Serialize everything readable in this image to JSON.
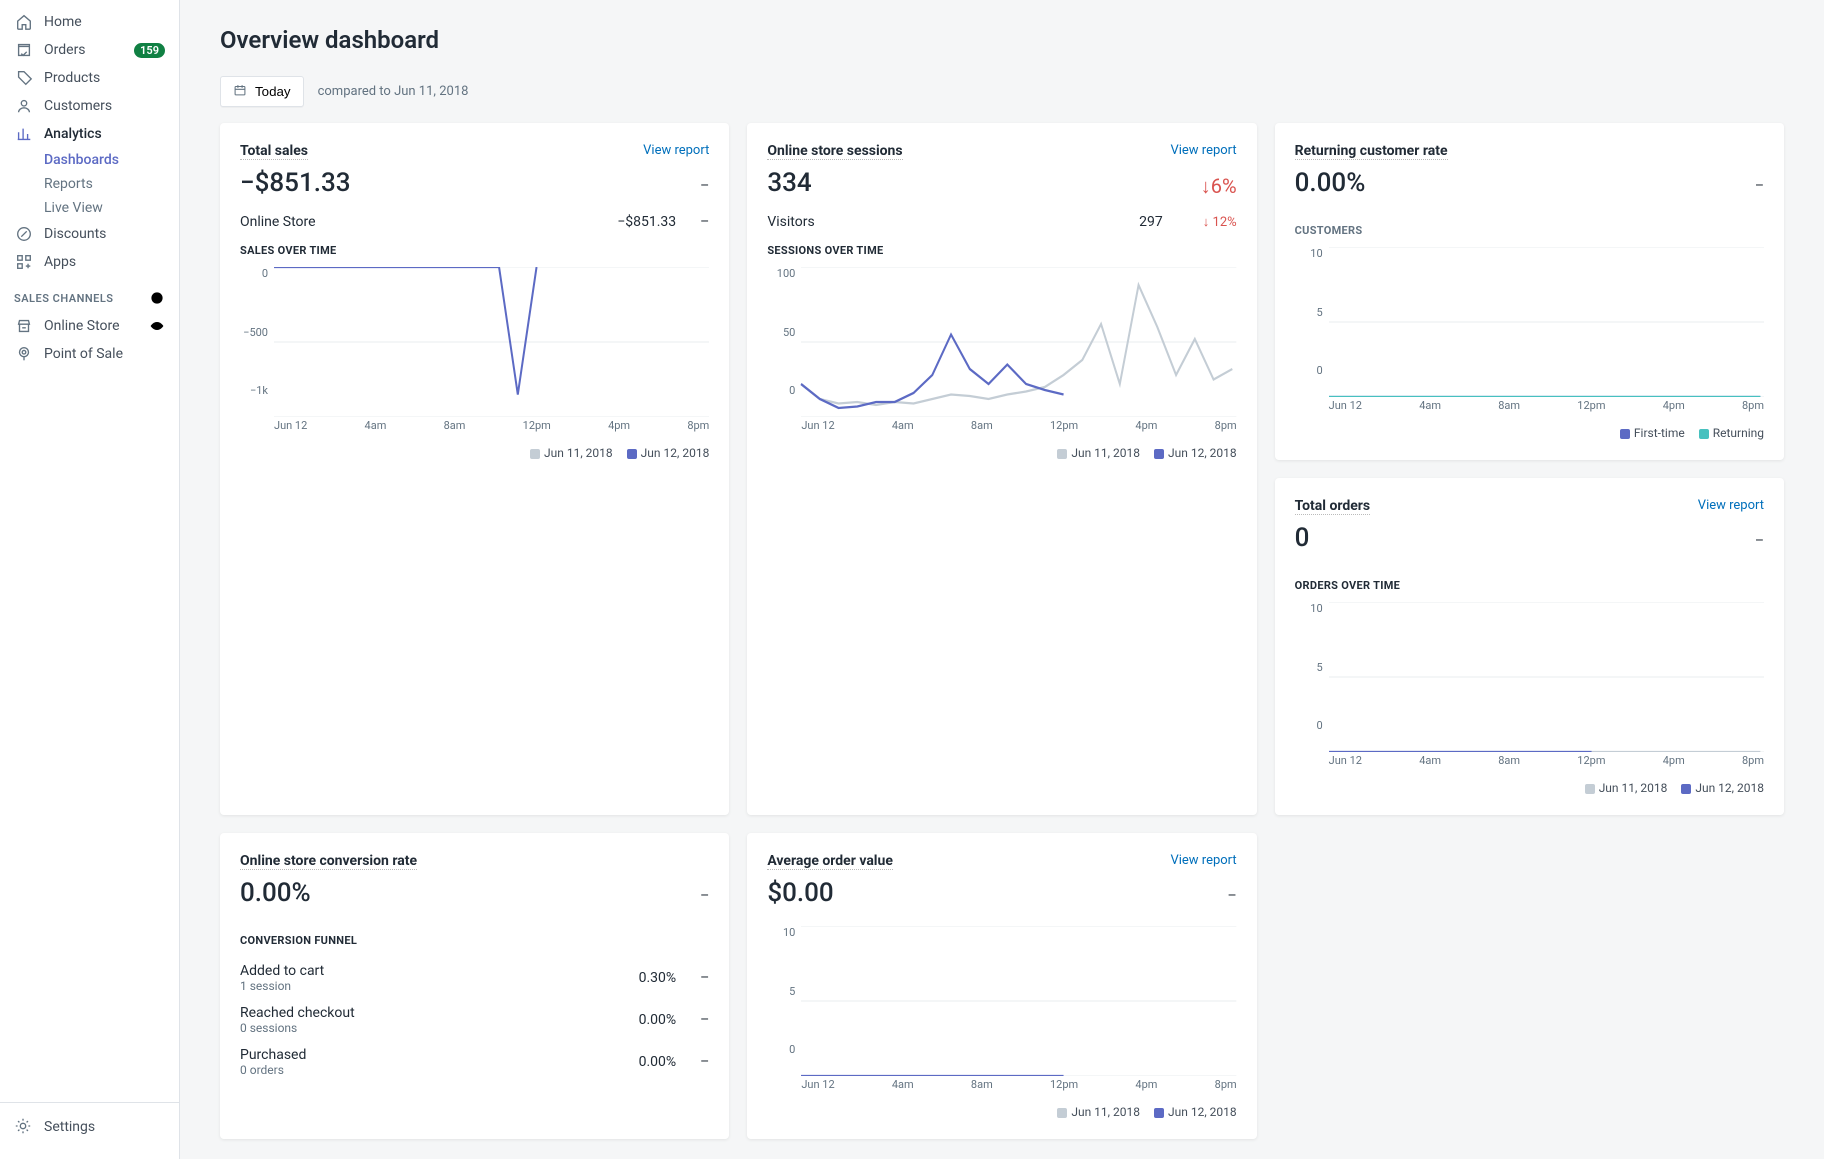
{
  "sidebar": {
    "items": [
      {
        "icon": "home",
        "label": "Home"
      },
      {
        "icon": "orders",
        "label": "Orders",
        "badge": "159"
      },
      {
        "icon": "tag",
        "label": "Products"
      },
      {
        "icon": "user",
        "label": "Customers"
      },
      {
        "icon": "chart",
        "label": "Analytics",
        "sub": [
          {
            "label": "Dashboards",
            "active": true
          },
          {
            "label": "Reports"
          },
          {
            "label": "Live View"
          }
        ]
      },
      {
        "icon": "discount",
        "label": "Discounts"
      },
      {
        "icon": "apps",
        "label": "Apps"
      }
    ],
    "channelsLabel": "SALES CHANNELS",
    "channels": [
      {
        "icon": "store",
        "label": "Online Store",
        "trailing": "eye"
      },
      {
        "icon": "pin",
        "label": "Point of Sale"
      }
    ],
    "settingsLabel": "Settings"
  },
  "header": {
    "title": "Overview dashboard",
    "dateButton": "Today",
    "compared": "compared to Jun 11, 2018"
  },
  "xTicks": [
    "Jun 12",
    "4am",
    "8am",
    "12pm",
    "4pm",
    "8pm"
  ],
  "legendDates": {
    "prev": "Jun 11, 2018",
    "curr": "Jun 12, 2018"
  },
  "card_sales": {
    "title": "Total sales",
    "viewReport": "View report",
    "value": "−$851.33",
    "dash": "–",
    "row": {
      "label": "Online Store",
      "value": "−$851.33",
      "dash": "–"
    },
    "subhead": "SALES OVER TIME"
  },
  "card_sessions": {
    "title": "Online store sessions",
    "viewReport": "View report",
    "value": "334",
    "delta": "6%",
    "row": {
      "label": "Visitors",
      "value": "297",
      "delta": "12%"
    },
    "subhead": "SESSIONS OVER TIME"
  },
  "card_return": {
    "title": "Returning customer rate",
    "value": "0.00%",
    "dash": "–",
    "subhead": "CUSTOMERS",
    "legend": {
      "a": "First-time",
      "b": "Returning"
    }
  },
  "card_conv": {
    "title": "Online store conversion rate",
    "value": "0.00%",
    "dash": "–",
    "subhead": "CONVERSION FUNNEL",
    "rows": [
      {
        "label": "Added to cart",
        "sub": "1 session",
        "pct": "0.30%",
        "dash": "–"
      },
      {
        "label": "Reached checkout",
        "sub": "0 sessions",
        "pct": "0.00%",
        "dash": "–"
      },
      {
        "label": "Purchased",
        "sub": "0 orders",
        "pct": "0.00%",
        "dash": "–"
      }
    ]
  },
  "card_aov": {
    "title": "Average order value",
    "viewReport": "View report",
    "value": "$0.00",
    "dash": "–"
  },
  "card_orders": {
    "title": "Total orders",
    "viewReport": "View report",
    "value": "0",
    "dash": "–",
    "subhead": "ORDERS OVER TIME"
  },
  "chart_data": [
    {
      "id": "sales",
      "type": "line",
      "title": "SALES OVER TIME",
      "x": [
        "Jun 12",
        "4am",
        "8am",
        "12pm",
        "4pm",
        "8pm"
      ],
      "ylim": [
        -1000,
        0
      ],
      "yticks": [
        "0",
        "−500",
        "−1k"
      ],
      "series": [
        {
          "name": "Jun 12, 2018",
          "color": "#5c6ac4",
          "values": [
            0,
            0,
            0,
            0,
            0,
            0,
            0,
            0,
            0,
            0,
            0,
            0,
            0,
            -850,
            0,
            null,
            null,
            null,
            null,
            null,
            null,
            null,
            null,
            null
          ]
        }
      ]
    },
    {
      "id": "sessions",
      "type": "line",
      "title": "SESSIONS OVER TIME",
      "x": [
        "Jun 12",
        "4am",
        "8am",
        "12pm",
        "4pm",
        "8pm"
      ],
      "ylim": [
        0,
        100
      ],
      "yticks": [
        "100",
        "50",
        "0"
      ],
      "series": [
        {
          "name": "Jun 11, 2018",
          "color": "#c4cdd5",
          "values": [
            22,
            12,
            9,
            10,
            8,
            10,
            9,
            12,
            15,
            14,
            12,
            15,
            17,
            20,
            28,
            38,
            62,
            22,
            88,
            60,
            28,
            52,
            25,
            32
          ]
        },
        {
          "name": "Jun 12, 2018",
          "color": "#5c6ac4",
          "values": [
            22,
            12,
            6,
            7,
            10,
            10,
            16,
            28,
            55,
            32,
            22,
            35,
            22,
            18,
            15,
            null,
            null,
            null,
            null,
            null,
            null,
            null,
            null,
            null
          ]
        }
      ]
    },
    {
      "id": "customers",
      "type": "line",
      "title": "CUSTOMERS",
      "x": [
        "Jun 12",
        "4am",
        "8am",
        "12pm",
        "4pm",
        "8pm"
      ],
      "ylim": [
        0,
        10
      ],
      "yticks": [
        "10",
        "5",
        "0"
      ],
      "series": [
        {
          "name": "First-time",
          "color": "#5c6ac4",
          "values": [
            0,
            0,
            0,
            0,
            0,
            0,
            0,
            0,
            0,
            0,
            0,
            0,
            0,
            0,
            0,
            0,
            0,
            0,
            0,
            0,
            0,
            0,
            0,
            0
          ]
        },
        {
          "name": "Returning",
          "color": "#47c1bf",
          "values": [
            0,
            0,
            0,
            0,
            0,
            0,
            0,
            0,
            0,
            0,
            0,
            0,
            0,
            0,
            0,
            0,
            0,
            0,
            0,
            0,
            0,
            0,
            0,
            0
          ]
        }
      ]
    },
    {
      "id": "aov",
      "type": "line",
      "title": "AVERAGE ORDER VALUE",
      "x": [
        "Jun 12",
        "4am",
        "8am",
        "12pm",
        "4pm",
        "8pm"
      ],
      "ylim": [
        0,
        10
      ],
      "yticks": [
        "10",
        "5",
        "0"
      ],
      "series": [
        {
          "name": "Jun 12, 2018",
          "color": "#5c6ac4",
          "values": [
            0,
            0,
            0,
            0,
            0,
            0,
            0,
            0,
            0,
            0,
            0,
            0,
            0,
            0,
            0,
            null,
            null,
            null,
            null,
            null,
            null,
            null,
            null,
            null
          ]
        }
      ]
    },
    {
      "id": "orders",
      "type": "line",
      "title": "ORDERS OVER TIME",
      "x": [
        "Jun 12",
        "4am",
        "8am",
        "12pm",
        "4pm",
        "8pm"
      ],
      "ylim": [
        0,
        10
      ],
      "yticks": [
        "10",
        "5",
        "0"
      ],
      "series": [
        {
          "name": "Jun 11, 2018",
          "color": "#c4cdd5",
          "values": [
            0,
            0,
            0,
            0,
            0,
            0,
            0,
            0,
            0,
            0,
            0,
            0,
            0,
            0,
            0,
            0,
            0,
            0,
            0,
            0,
            0,
            0,
            0,
            0
          ]
        },
        {
          "name": "Jun 12, 2018",
          "color": "#5c6ac4",
          "values": [
            0,
            0,
            0,
            0,
            0,
            0,
            0,
            0,
            0,
            0,
            0,
            0,
            0,
            0,
            0,
            null,
            null,
            null,
            null,
            null,
            null,
            null,
            null,
            null
          ]
        }
      ]
    }
  ]
}
